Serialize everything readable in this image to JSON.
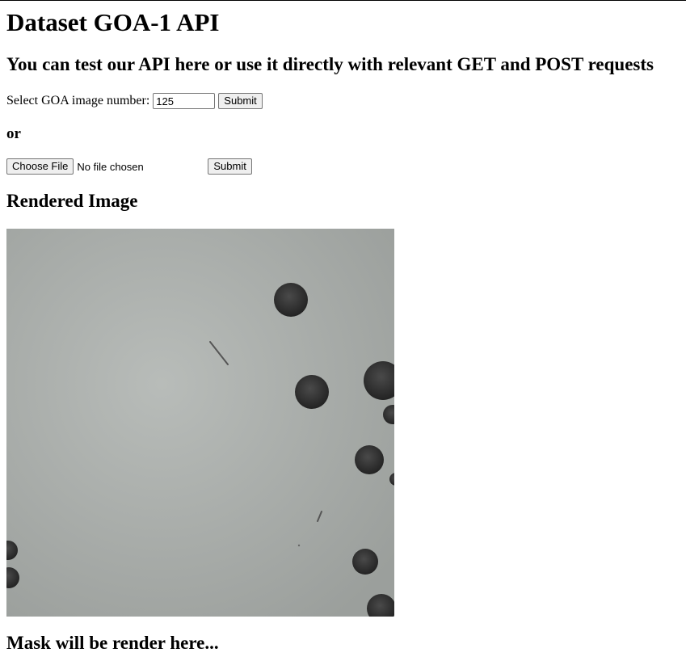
{
  "page": {
    "title": "Dataset GOA-1 API",
    "subtitle": "You can test our API here or use it directly with relevant GET and POST requests"
  },
  "select_form": {
    "label": "Select GOA image number:",
    "value": "125",
    "submit_label": "Submit"
  },
  "separator": "or",
  "file_form": {
    "choose_label": "Choose File",
    "status": "No file chosen",
    "submit_label": "Submit"
  },
  "rendered": {
    "heading": "Rendered Image"
  },
  "mask": {
    "heading": "Mask will be render here..."
  }
}
